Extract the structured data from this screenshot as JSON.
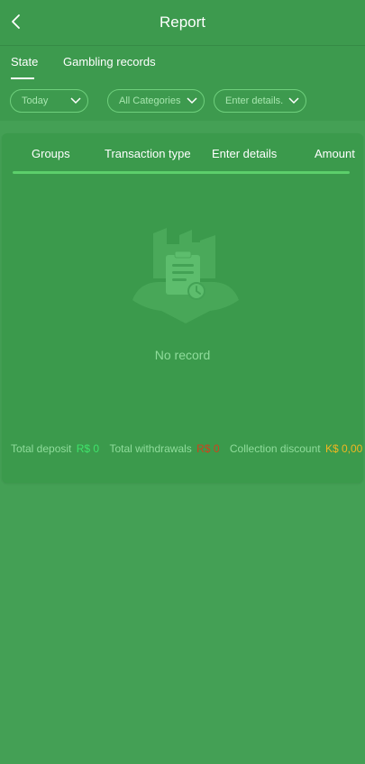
{
  "header": {
    "title": "Report",
    "back_icon": "chevron-left-icon"
  },
  "tabs": [
    {
      "label": "State",
      "active": true
    },
    {
      "label": "Gambling records",
      "active": false
    }
  ],
  "filters": {
    "date": {
      "value": "Today",
      "icon": "chevron-down-icon"
    },
    "category": {
      "value": "All Categories",
      "icon": "chevron-down-icon"
    },
    "details": {
      "placeholder": "Enter details.",
      "icon": "chevron-down-icon"
    }
  },
  "table": {
    "columns": [
      "Groups",
      "Transaction type",
      "Enter details",
      "Amount"
    ]
  },
  "empty_state": {
    "text": "No record",
    "icon": "clipboard-icon"
  },
  "totals": {
    "deposit_label": "Total deposit",
    "deposit_value": "R$ 0",
    "withdrawals_label": "Total withdrawals",
    "withdrawals_value": "R$ 0",
    "discount_label": "Collection discount",
    "discount_value": "K$ 0,00"
  },
  "colors": {
    "background": "#44a055",
    "accent": "#5ccf6b",
    "deposit_value": "#3fe36b",
    "withdrawals_value": "#d0421c",
    "discount_value": "#f2b620"
  }
}
